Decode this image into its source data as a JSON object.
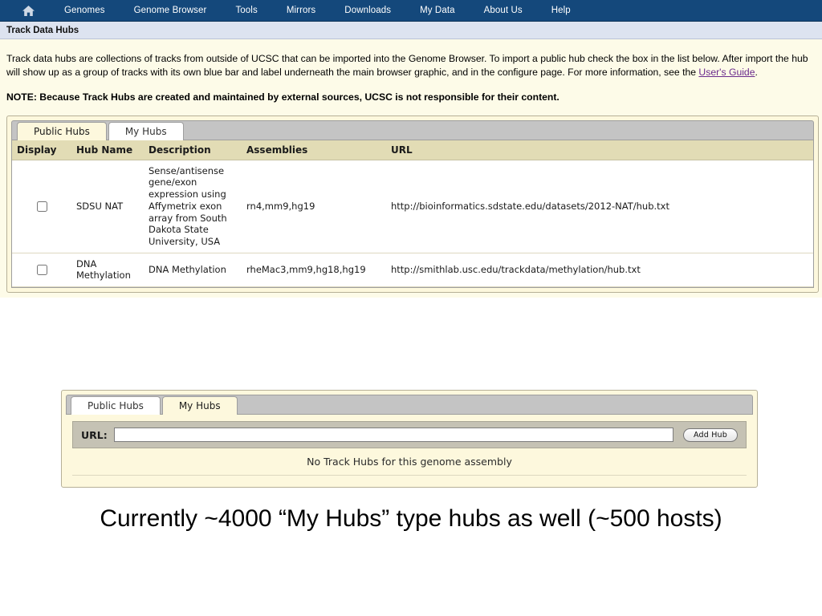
{
  "nav": {
    "home_icon": "home-icon",
    "items": [
      {
        "label": "Genomes"
      },
      {
        "label": "Genome Browser"
      },
      {
        "label": "Tools"
      },
      {
        "label": "Mirrors"
      },
      {
        "label": "Downloads"
      },
      {
        "label": "My Data"
      },
      {
        "label": "About Us"
      },
      {
        "label": "Help"
      }
    ],
    "background_color": "#14487b"
  },
  "page": {
    "title": "Track Data Hubs",
    "title_band_color": "#dde3f0",
    "body_background": "#fdfbe8"
  },
  "intro": {
    "part1": "Track data hubs are collections of tracks from outside of UCSC that can be imported into the Genome Browser. To import a public hub check the box in the list below. After import the hub will show up as a group of tracks with its own blue bar and label underneath the main browser graphic, and in the configure page. For more information, see the ",
    "link_text": "User's Guide",
    "part2": ".",
    "link_color": "#6a2a8c",
    "note": "NOTE: Because Track Hubs are created and maintained by external sources, UCSC is not responsible for their content."
  },
  "panel_top": {
    "tabs": [
      {
        "label": "Public Hubs",
        "active": true
      },
      {
        "label": "My Hubs",
        "active": false
      }
    ],
    "table": {
      "columns": [
        "Display",
        "Hub Name",
        "Description",
        "Assemblies",
        "URL"
      ],
      "rows": [
        {
          "display_checked": false,
          "hub_name": "SDSU NAT",
          "description": "Sense/antisense gene/exon expression using Affymetrix exon array from South Dakota State University, USA",
          "assemblies": "rn4,mm9,hg19",
          "url": "http://bioinformatics.sdstate.edu/datasets/2012-NAT/hub.txt"
        },
        {
          "display_checked": false,
          "hub_name": "DNA Methylation",
          "description": "DNA Methylation",
          "assemblies": "rheMac3,mm9,hg18,hg19",
          "url": "http://smithlab.usc.edu/trackdata/methylation/hub.txt"
        }
      ],
      "header_color": "#e2dcb5"
    }
  },
  "panel_lower": {
    "tabs": [
      {
        "label": "Public Hubs",
        "active": false
      },
      {
        "label": "My Hubs",
        "active": true
      }
    ],
    "url_label": "URL:",
    "url_value": "",
    "url_placeholder": "",
    "add_hub_label": "Add Hub",
    "empty_message": "No Track Hubs for this genome assembly"
  },
  "caption": {
    "text": "Currently ~4000 “My Hubs” type hubs as well (~500 hosts)"
  }
}
